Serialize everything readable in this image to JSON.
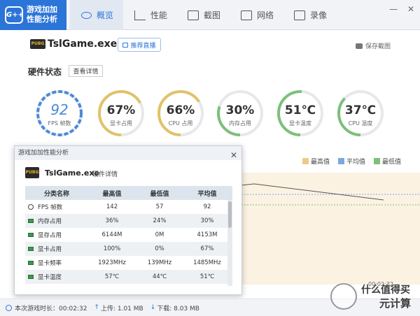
{
  "app": {
    "logo_mark": "G++",
    "logo_line1": "游戏加加",
    "logo_line2": "性能分析"
  },
  "tabs": [
    {
      "label": "概览"
    },
    {
      "label": "性能"
    },
    {
      "label": "截图"
    },
    {
      "label": "网络"
    },
    {
      "label": "录像"
    }
  ],
  "window_controls": {
    "minimize": "—",
    "close": "✕"
  },
  "game": {
    "icon_text": "PUBG",
    "name": "TslGame.exe",
    "recommend_label": "推荐直播",
    "save_label": "保存截图"
  },
  "hardware": {
    "title": "硬件状态",
    "detail_label": "查看详情",
    "gauges": [
      {
        "value": "92",
        "label": "FPS 帧数",
        "color": "#4a8ad8",
        "fill": 0.92
      },
      {
        "value": "67%",
        "label": "显卡占用",
        "color": "#e0c36a",
        "fill": 0.67
      },
      {
        "value": "66%",
        "label": "CPU 占用",
        "color": "#e0c36a",
        "fill": 0.66
      },
      {
        "value": "30%",
        "label": "内存占用",
        "color": "#7cc07a",
        "fill": 0.3
      },
      {
        "value": "51℃",
        "label": "显卡温度",
        "color": "#7cc07a",
        "fill": 0.51
      },
      {
        "value": "37℃",
        "label": "CPU 温度",
        "color": "#7cc07a",
        "fill": 0.37
      }
    ]
  },
  "legend": [
    {
      "label": "最高值",
      "color": "#f0c98a"
    },
    {
      "label": "平均值",
      "color": "#7aa9e0"
    },
    {
      "label": "最低值",
      "color": "#7cc07a"
    }
  ],
  "chart_time": "00:02:32",
  "popup": {
    "title": "游戏加加性能分析",
    "close": "✕",
    "game_icon": "PUBG",
    "game_name": "TslGame.exe",
    "subtitle": "硬件详情",
    "headers": [
      "分类名称",
      "最高值",
      "最低值",
      "平均值"
    ],
    "rows": [
      {
        "name": "FPS 帧数",
        "max": "142",
        "min": "57",
        "avg": "92"
      },
      {
        "name": "内存占用",
        "max": "36%",
        "min": "24%",
        "avg": "30%"
      },
      {
        "name": "显存占用",
        "max": "6144M",
        "min": "0M",
        "avg": "4153M"
      },
      {
        "name": "显卡占用",
        "max": "100%",
        "min": "0%",
        "avg": "67%"
      },
      {
        "name": "显卡频率",
        "max": "1923MHz",
        "min": "139MHz",
        "avg": "1485MHz"
      },
      {
        "name": "显卡温度",
        "max": "57℃",
        "min": "44℃",
        "avg": "51℃"
      }
    ]
  },
  "status": {
    "duration": "本次游戏时长：00:02:32",
    "upload": "上传: 1.01 MB",
    "download": "下载: 8.03 MB"
  },
  "watermark": {
    "line1": "什么值得买",
    "line2": "元计算"
  }
}
